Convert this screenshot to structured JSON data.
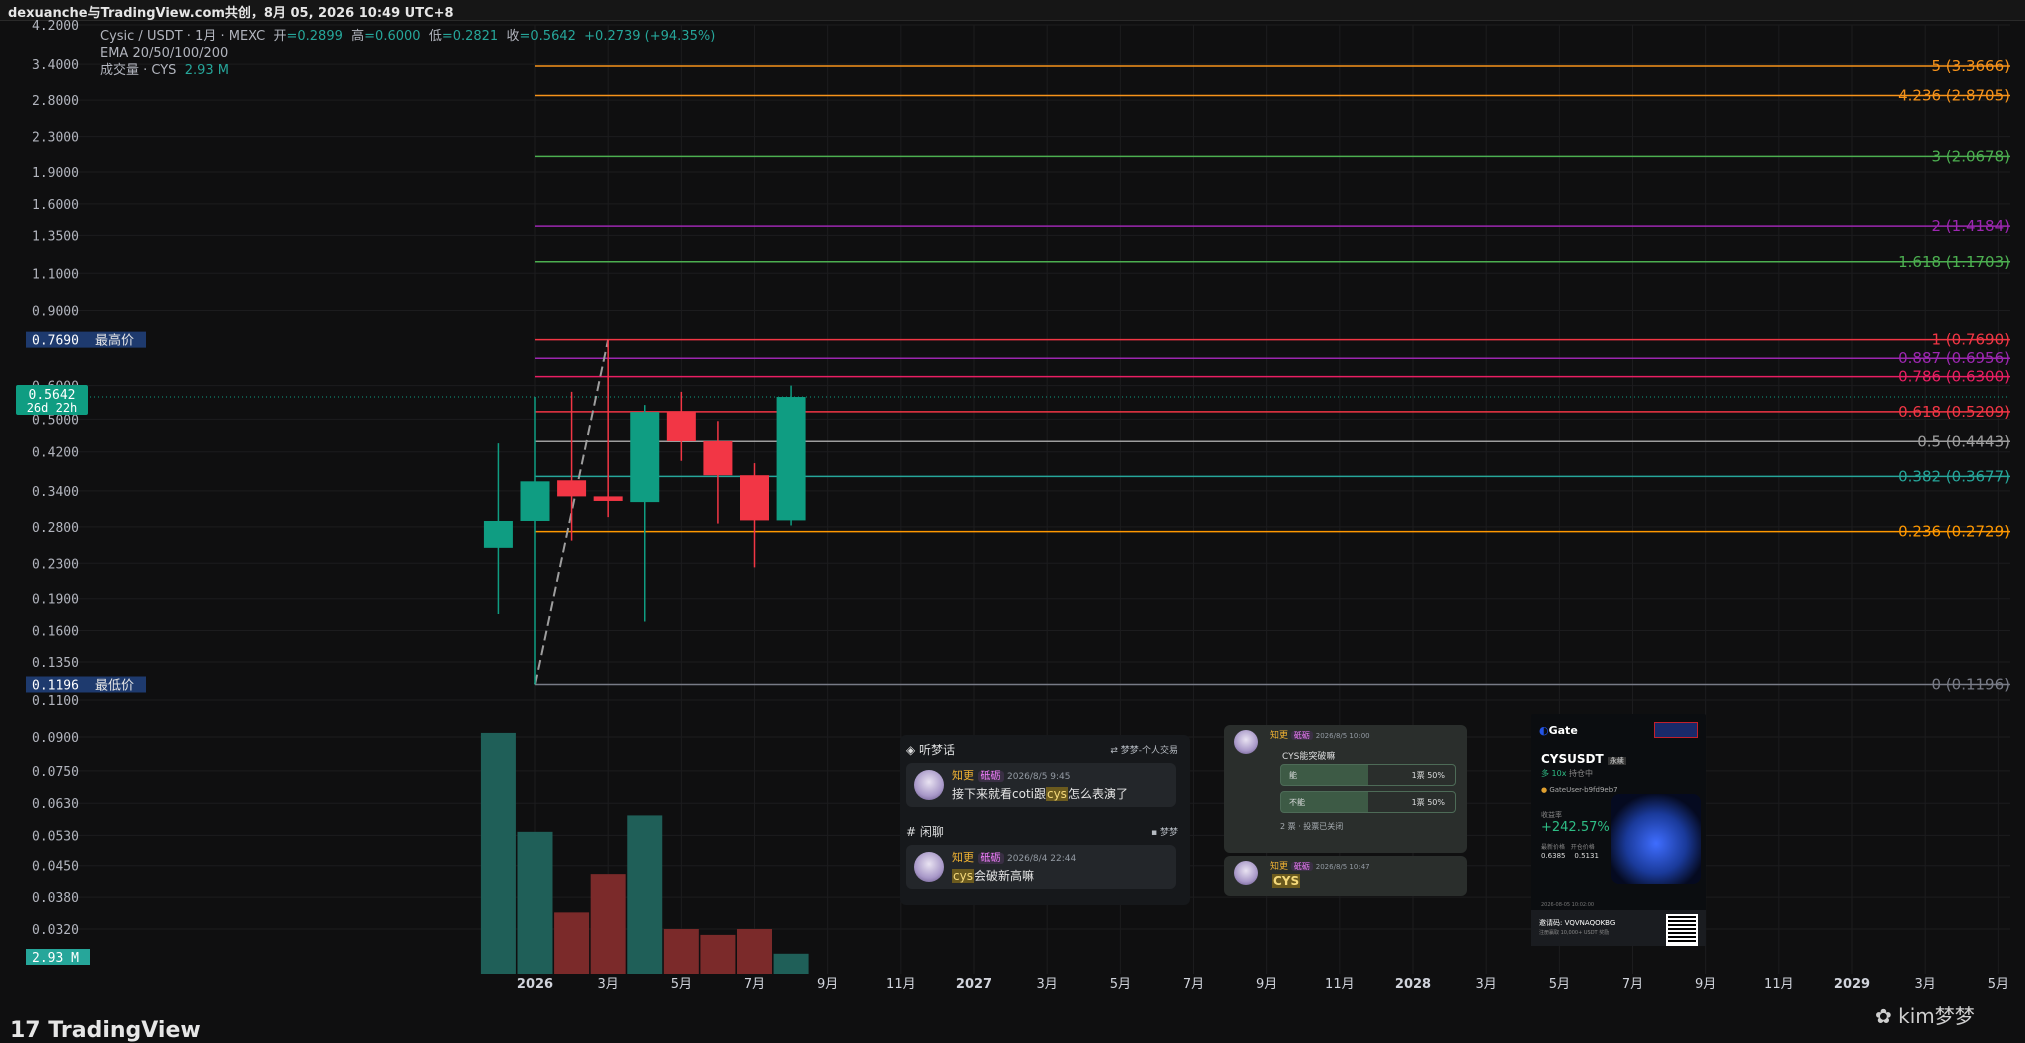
{
  "header": {
    "text": "dexuanche与TradingView.com共创，8月 05, 2026 10:49 UTC+8"
  },
  "legend": {
    "line1_prefix": "Cysic / USDT · 1月 · MEXC",
    "open_label": "开",
    "open": "=0.2899",
    "high_label": "高",
    "high": "=0.6000",
    "low_label": "低",
    "low": "=0.2821",
    "close_label": "收",
    "close": "=0.5642",
    "change": "+0.2739 (+94.35%)",
    "line2": "EMA 20/50/100/200",
    "line3_prefix": "成交量 · CYS",
    "volume": "2.93 M"
  },
  "footer": {
    "logo": "TradingView",
    "watermark": "kim梦梦"
  },
  "colors": {
    "bg": "#0f0f10",
    "up": "#0f9d82",
    "down": "#f23645",
    "vol_up": "#1f5f58",
    "vol_down": "#7b2a2a",
    "grid": "#1c1c1e"
  },
  "chart_data": {
    "type": "candlestick",
    "price_axis_ticks": [
      "4.2000",
      "3.4000",
      "2.8000",
      "2.3000",
      "1.9000",
      "1.6000",
      "1.3500",
      "1.1000",
      "0.9000",
      "0.6000",
      "0.5000",
      "0.4200",
      "0.3400",
      "0.2800",
      "0.2300",
      "0.1900",
      "0.1600",
      "0.1350",
      "0.1100"
    ],
    "price_tick_values": [
      4.2,
      3.4,
      2.8,
      2.3,
      1.9,
      1.6,
      1.35,
      1.1,
      0.9,
      0.6,
      0.5,
      0.42,
      0.34,
      0.28,
      0.23,
      0.19,
      0.16,
      0.135,
      0.11
    ],
    "volume_axis_ticks": [
      "0.0900",
      "0.0750",
      "0.0630",
      "0.0530",
      "0.0450",
      "0.0380",
      "0.0320"
    ],
    "volume_tick_values": [
      0.09,
      0.075,
      0.063,
      0.053,
      0.045,
      0.038,
      0.032
    ],
    "x_axis_labels": [
      "2026",
      "3月",
      "5月",
      "7月",
      "9月",
      "11月",
      "2027",
      "3月",
      "5月",
      "7月",
      "9月",
      "11月",
      "2028",
      "3月",
      "5月",
      "7月",
      "9月",
      "11月",
      "2029",
      "3月",
      "5月"
    ],
    "x_axis_months": [
      12,
      14,
      16,
      18,
      20,
      22,
      24,
      26,
      28,
      30,
      32,
      34,
      36,
      38,
      40,
      42,
      44,
      46,
      48,
      50,
      52
    ],
    "candles": [
      {
        "m": 11,
        "o": 0.25,
        "h": 0.44,
        "l": 0.175,
        "c": 0.289
      },
      {
        "m": 12,
        "o": 0.289,
        "h": 0.5642,
        "l": 0.1196,
        "c": 0.358
      },
      {
        "m": 13,
        "o": 0.36,
        "h": 0.58,
        "l": 0.26,
        "c": 0.33
      },
      {
        "m": 14,
        "o": 0.33,
        "h": 0.769,
        "l": 0.295,
        "c": 0.322
      },
      {
        "m": 15,
        "o": 0.32,
        "h": 0.54,
        "l": 0.168,
        "c": 0.52
      },
      {
        "m": 16,
        "o": 0.52,
        "h": 0.58,
        "l": 0.4,
        "c": 0.445
      },
      {
        "m": 17,
        "o": 0.445,
        "h": 0.495,
        "l": 0.285,
        "c": 0.37
      },
      {
        "m": 18,
        "o": 0.37,
        "h": 0.395,
        "l": 0.225,
        "c": 0.2899
      },
      {
        "m": 19,
        "o": 0.2899,
        "h": 0.6,
        "l": 0.2821,
        "c": 0.5642
      }
    ],
    "volumes": [
      {
        "m": 11,
        "v": 0.092,
        "dir": "up"
      },
      {
        "m": 12,
        "v": 0.054,
        "dir": "up"
      },
      {
        "m": 13,
        "v": 0.035,
        "dir": "down"
      },
      {
        "m": 14,
        "v": 0.043,
        "dir": "down"
      },
      {
        "m": 15,
        "v": 0.059,
        "dir": "up"
      },
      {
        "m": 16,
        "v": 0.032,
        "dir": "down"
      },
      {
        "m": 17,
        "v": 0.031,
        "dir": "down"
      },
      {
        "m": 18,
        "v": 0.032,
        "dir": "down"
      },
      {
        "m": 19,
        "v": 0.028,
        "dir": "up"
      }
    ],
    "fib_levels": [
      {
        "label": "5 (3.3666)",
        "v": 3.3666,
        "color": "#f7931a"
      },
      {
        "label": "4.236 (2.8705)",
        "v": 2.8705,
        "color": "#f7931a"
      },
      {
        "label": "3 (2.0678)",
        "v": 2.0678,
        "color": "#4caf50"
      },
      {
        "label": "2 (1.4184)",
        "v": 1.4184,
        "color": "#9c27b0"
      },
      {
        "label": "1.618 (1.1703)",
        "v": 1.1703,
        "color": "#4caf50"
      },
      {
        "label": "1 (0.7690)",
        "v": 0.769,
        "color": "#f23645"
      },
      {
        "label": "0.887 (0.6956)",
        "v": 0.6956,
        "color": "#9c27b0"
      },
      {
        "label": "0.786 (0.6300)",
        "v": 0.63,
        "color": "#e91e63"
      },
      {
        "label": "0.618 (0.5209)",
        "v": 0.5209,
        "color": "#f23645"
      },
      {
        "label": "0.5 (0.4443)",
        "v": 0.4443,
        "color": "#9e9e9e"
      },
      {
        "label": "0.382 (0.3677)",
        "v": 0.3677,
        "color": "#26a69a"
      },
      {
        "label": "0.236 (0.2729)",
        "v": 0.2729,
        "color": "#ff9800"
      },
      {
        "label": "0 (0.1196)",
        "v": 0.1196,
        "color": "#787b86"
      }
    ],
    "fib_anchor_low": {
      "m": 12,
      "v": 0.1196
    },
    "fib_anchor_high": {
      "m": 14,
      "v": 0.769
    },
    "badges": {
      "high_value": "0.7690",
      "high_text": "最高价",
      "low_value": "0.1196",
      "low_text": "最低价",
      "last_value": "0.5642",
      "countdown": "26d 22h",
      "volume_value": "2.93 M"
    }
  },
  "overlay_chat": {
    "channel1": "听梦话",
    "channel1_right": "梦梦-个人交易",
    "user": "知更",
    "badge": "砥砺",
    "msg1_time": "2026/8/5 9:45",
    "msg1_pre": "接下来就看coti跟",
    "msg1_hl": "cys",
    "msg1_post": "怎么表演了",
    "channel2": "闲聊",
    "channel2_right": "梦梦",
    "msg2_time": "2026/8/4 22:44",
    "msg2_hl": "cys",
    "msg2_post": "会破新高嘛"
  },
  "overlay_poll": {
    "user": "知更",
    "badge": "砥砺",
    "time": "2026/8/5 10:00",
    "question": "CYS能突破嘛",
    "opt1": "能",
    "opt1_votes": "1票",
    "opt1_pct": "50%",
    "opt2": "不能",
    "opt2_votes": "1票",
    "opt2_pct": "50%",
    "footer": "2 票 · 投票已关闭"
  },
  "overlay_reply": {
    "user": "知更",
    "badge": "砥砺",
    "time": "2026/8/5 10:47",
    "text": "CYS"
  },
  "overlay_gate": {
    "brand": "Gate",
    "pair": "CYSUSDT",
    "pair_tag": "永续",
    "lev": "多 10x",
    "lev_tag": "持仓中",
    "user": "GateUser-b9fd9eb7",
    "pnl_label": "收益率",
    "pnl": "+242.57%",
    "p1_label": "最新价格",
    "p1": "0.6385",
    "p2_label": "开仓价格",
    "p2": "0.5131",
    "date": "2026-08-05 10:02:00",
    "invite_label": "邀请码: VQVNAQOKBG",
    "invite_sub": "注册赢取 10,000+ USDT 奖励"
  }
}
